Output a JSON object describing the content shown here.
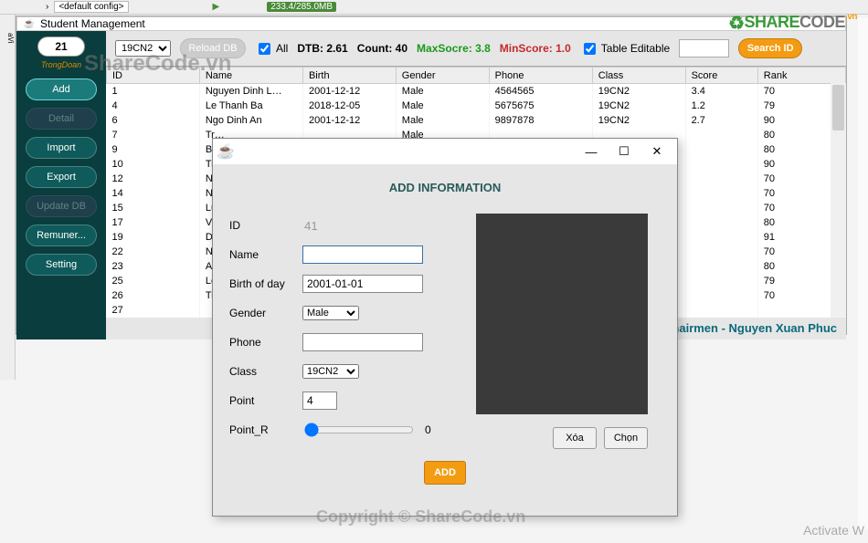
{
  "window_title": "Student Management",
  "top_default": "<default config>",
  "top_mem": "233.4/285.0MB",
  "leftstrip_label": "aVi",
  "sidebar": {
    "number": "21",
    "user": "TrongDoan",
    "add": "Add",
    "detail": "Detail",
    "import": "Import",
    "export": "Export",
    "updatedb": "Update DB",
    "remuner": "Remuner...",
    "setting": "Setting"
  },
  "toolbar": {
    "class_select": "19CN2",
    "reload": "Reload DB",
    "all": "All",
    "dtb": "DTB: 2.61",
    "count": "Count: 40",
    "max": "MaxSocre: 3.8",
    "min": "MinScore: 1.0",
    "editable": "Table Editable",
    "searchbtn": "Search ID"
  },
  "columns": [
    "ID",
    "Name",
    "Birth",
    "Gender",
    "Phone",
    "Class",
    "Score",
    "Rank"
  ],
  "rows": [
    [
      "1",
      "Nguyen Dinh L…",
      "2001-12-12",
      "Male",
      "4564565",
      "19CN2",
      "3.4",
      "70"
    ],
    [
      "4",
      "Le Thanh Ba",
      "2018-12-05",
      "Male",
      "5675675",
      "19CN2",
      "1.2",
      "79"
    ],
    [
      "6",
      "Ngo Dinh An",
      "2001-12-12",
      "Male",
      "9897878",
      "19CN2",
      "2.7",
      "90"
    ],
    [
      "7",
      "Tr…",
      "",
      "Male",
      "",
      "",
      "",
      "80"
    ],
    [
      "9",
      "Bu",
      "",
      "",
      "",
      "",
      "",
      "80"
    ],
    [
      "10",
      "Tr",
      "",
      "",
      "",
      "",
      "",
      "90"
    ],
    [
      "12",
      "Ng",
      "",
      "",
      "",
      "",
      "",
      "70"
    ],
    [
      "14",
      "Ng",
      "",
      "",
      "",
      "",
      "",
      "70"
    ],
    [
      "15",
      "Lu",
      "",
      "",
      "",
      "",
      "",
      "70"
    ],
    [
      "17",
      "Vu",
      "",
      "",
      "",
      "",
      "",
      "80"
    ],
    [
      "19",
      "Da",
      "",
      "",
      "",
      "",
      "",
      "91"
    ],
    [
      "22",
      "Ng",
      "",
      "",
      "",
      "",
      "",
      "70"
    ],
    [
      "23",
      "An",
      "",
      "",
      "",
      "",
      "",
      "80"
    ],
    [
      "25",
      "Le",
      "",
      "",
      "",
      "",
      "",
      "79"
    ],
    [
      "26",
      "Tr",
      "",
      "",
      "",
      "",
      "",
      "70"
    ],
    [
      "27",
      "",
      "",
      "",
      "",
      "",
      "",
      ""
    ]
  ],
  "footer": "…hairmen - Nguyen Xuan Phuc",
  "dialog": {
    "title": "ADD INFORMATION",
    "labels": {
      "id": "ID",
      "name": "Name",
      "birth": "Birth of day",
      "gender": "Gender",
      "phone": "Phone",
      "class": "Class",
      "point": "Point",
      "pointr": "Point_R"
    },
    "values": {
      "id": "41",
      "name": "",
      "birth": "2001-01-01",
      "gender": "Male",
      "phone": "",
      "class": "19CN2",
      "point": "4",
      "pointr_end": "0"
    },
    "delete": "Xóa",
    "choose": "Chọn",
    "add": "ADD"
  },
  "watermark1": "ShareCode.vn",
  "watermark2": "Copyright © ShareCode.vn",
  "logo_a": "SHARE",
  "logo_b": "CODE",
  "logo_c": ".vn",
  "activate": "Activate W"
}
